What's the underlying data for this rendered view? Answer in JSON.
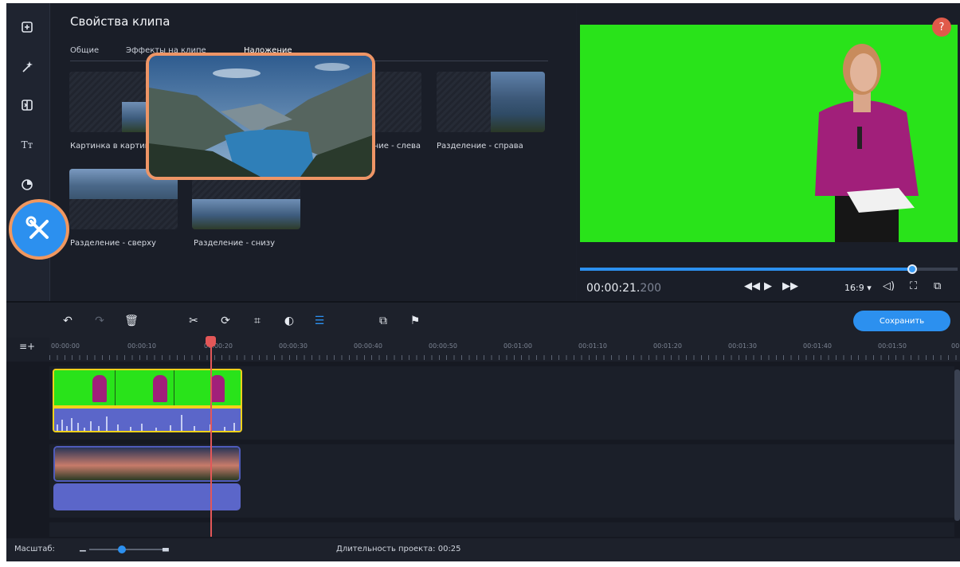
{
  "panel": {
    "title": "Свойства клипа",
    "tabs": [
      "Общие",
      "Эффекты на клипе",
      "Наложение"
    ],
    "cards": [
      {
        "label": "Картинка в картинке"
      },
      {
        "label": "Разделение - слева"
      },
      {
        "label": "Разделение - справа"
      },
      {
        "label": "Разделение - сверху"
      },
      {
        "label": "Разделение - снизу"
      }
    ]
  },
  "sidebar": {
    "items": [
      "import-icon",
      "magic-wand-icon",
      "transitions-icon",
      "titles-icon",
      "stickers-icon"
    ],
    "active_tool": "wrench-screwdriver-icon"
  },
  "preview": {
    "timecode_main": "00:00:21.",
    "timecode_ms": "200",
    "aspect": "16:9 ▾",
    "help": "?",
    "progress": 0.88
  },
  "toolbar": {
    "save_label": "Сохранить"
  },
  "ruler": {
    "ticks": [
      "00:00:00",
      "00:00:10",
      "00:00:20",
      "00:00:30",
      "00:00:40",
      "00:00:50",
      "00:01:00",
      "00:01:10",
      "00:01:20",
      "00:01:30",
      "00:01:40",
      "00:01:50",
      "00:"
    ]
  },
  "status": {
    "scale_label": "Масштаб:",
    "duration_label": "Длительность проекта: 00:25",
    "zoom_level": 0.45
  },
  "colors": {
    "accent": "#2c90ef",
    "highlight": "#f0975f",
    "chroma": "#29e31a",
    "selected_clip_border": "#f2d21a",
    "playhead": "#e35758"
  }
}
